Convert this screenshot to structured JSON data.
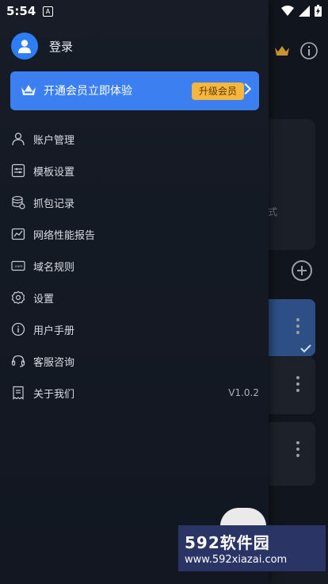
{
  "status_bar": {
    "time": "5:54",
    "notif_letter": "A"
  },
  "drawer": {
    "login_label": "登录",
    "vip": {
      "text": "开通会员立即体验",
      "upgrade_label": "升级会员"
    },
    "menu": [
      {
        "label": "账户管理",
        "icon": "user-icon"
      },
      {
        "label": "模板设置",
        "icon": "template-icon"
      },
      {
        "label": "抓包记录",
        "icon": "database-icon"
      },
      {
        "label": "网络性能报告",
        "icon": "chart-icon"
      },
      {
        "label": "域名规则",
        "icon": "domain-icon"
      },
      {
        "label": "设置",
        "icon": "gear-icon"
      },
      {
        "label": "用户手册",
        "icon": "info-icon"
      },
      {
        "label": "客服咨询",
        "icon": "headset-icon"
      },
      {
        "label": "关于我们",
        "icon": "receipt-icon",
        "version": "V1.0.2"
      }
    ]
  },
  "background": {
    "card_text": "式"
  },
  "watermark": {
    "title": "592软件园",
    "url": "www.592xiazai.com"
  },
  "colors": {
    "accent": "#3b7ff0",
    "vip_badge": "#f6b73c",
    "drawer_bg": "#161b25"
  }
}
